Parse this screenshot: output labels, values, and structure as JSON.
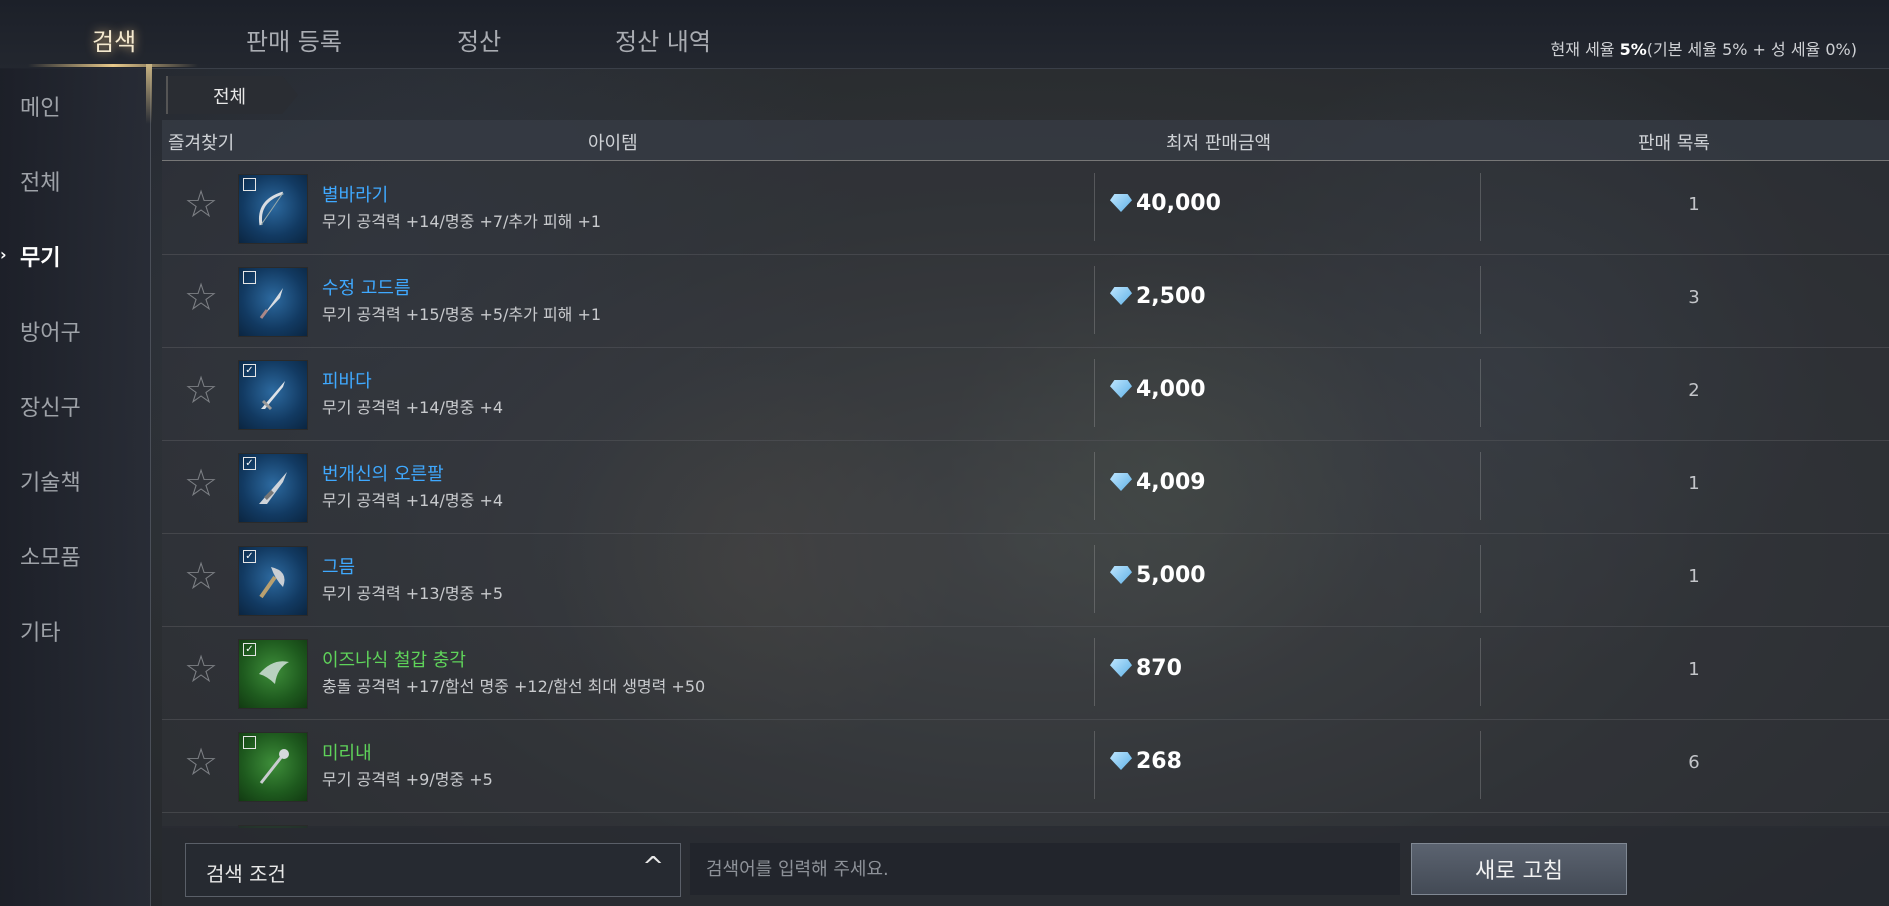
{
  "tabs": [
    {
      "label": "검색",
      "active": true
    },
    {
      "label": "판매 등록"
    },
    {
      "label": "정산"
    },
    {
      "label": "정산 내역"
    }
  ],
  "tax": {
    "prefix": "현재 세율 ",
    "rate": "5%",
    "detail": "(기본 세율 5% + 성 세율 0%)"
  },
  "sidebar": {
    "items": [
      {
        "label": "메인"
      },
      {
        "label": "전체"
      },
      {
        "label": "무기",
        "active": true
      },
      {
        "label": "방어구"
      },
      {
        "label": "장신구"
      },
      {
        "label": "기술책"
      },
      {
        "label": "소모품"
      },
      {
        "label": "기타"
      }
    ]
  },
  "breadcrumb": {
    "label": "전체"
  },
  "table": {
    "headers": {
      "favorite": "즐겨찾기",
      "item": "아이템",
      "lowest_price": "최저 판매금액",
      "listings": "판매 목록"
    },
    "rows": [
      {
        "name": "별바라기",
        "stats": "무기 공격력 +14/명중 +7/추가 피해 +1",
        "price": "40,000",
        "count": "1",
        "grade": "blue",
        "checked": false,
        "icon": "bow-icon"
      },
      {
        "name": "수정 고드름",
        "stats": "무기 공격력 +15/명중 +5/추가 피해 +1",
        "price": "2,500",
        "count": "3",
        "grade": "blue",
        "checked": false,
        "icon": "dagger-icon"
      },
      {
        "name": "피바다",
        "stats": "무기 공격력 +14/명중 +4",
        "price": "4,000",
        "count": "2",
        "grade": "blue",
        "checked": true,
        "icon": "sword-icon"
      },
      {
        "name": "번개신의 오른팔",
        "stats": "무기 공격력 +14/명중 +4",
        "price": "4,009",
        "count": "1",
        "grade": "blue",
        "checked": true,
        "icon": "greatsword-icon"
      },
      {
        "name": "그믐",
        "stats": "무기 공격력 +13/명중 +5",
        "price": "5,000",
        "count": "1",
        "grade": "blue",
        "checked": true,
        "icon": "axe-icon"
      },
      {
        "name": "이즈나식 철갑 충각",
        "stats": "충돌 공격력 +17/함선 명중 +12/함선 최대 생명력 +50",
        "price": "870",
        "count": "1",
        "grade": "green",
        "checked": true,
        "icon": "ram-icon"
      },
      {
        "name": "미리내",
        "stats": "무기 공격력 +9/명중 +5",
        "price": "268",
        "count": "6",
        "grade": "green",
        "checked": false,
        "icon": "staff-icon"
      }
    ]
  },
  "bottom": {
    "condition_label": "검색 조건",
    "search_placeholder": "검색어를 입력해 주세요.",
    "refresh_label": "새로 고침"
  }
}
